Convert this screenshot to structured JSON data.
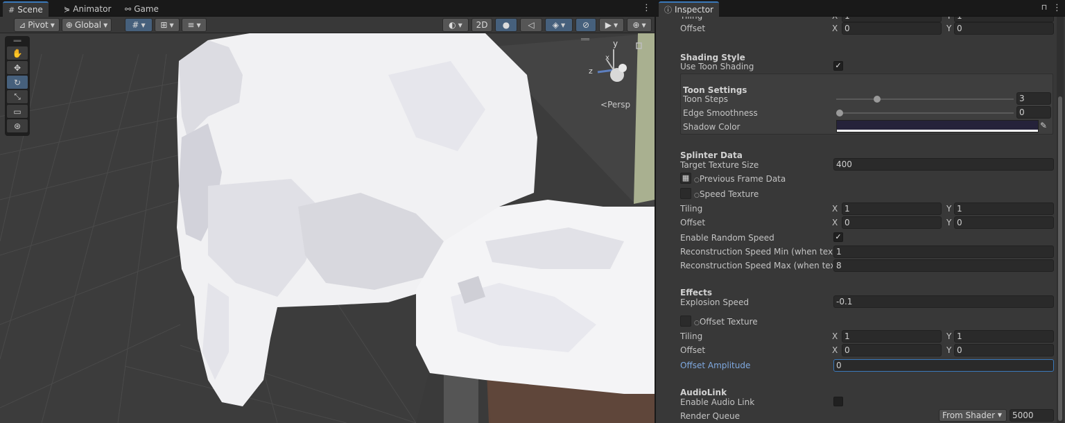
{
  "scene_panel": {
    "tabs": [
      {
        "label": "Scene",
        "icon": "grid-hash-icon"
      },
      {
        "label": "Animator",
        "icon": "animator-icon"
      },
      {
        "label": "Game",
        "icon": "gamepad-icon"
      }
    ],
    "toolbar": {
      "pivot_label": "Pivot",
      "global_label": "Global",
      "mode_2d_label": "2D"
    },
    "tools": [
      "hand-tool",
      "move-tool",
      "rotate-tool",
      "scale-tool",
      "rect-tool",
      "transform-tool"
    ],
    "gizmo": {
      "y_label": "y",
      "z_label": "z",
      "x_label": "x",
      "persp_label": "Persp"
    }
  },
  "inspector": {
    "tab_label": "Inspector",
    "top_partial": {
      "tiling_label": "Tiling",
      "tiling_x": "1",
      "tiling_y": "1"
    },
    "offset_1": {
      "label": "Offset",
      "x": "0",
      "y": "0"
    },
    "shading_style": {
      "header": "Shading Style",
      "use_toon_label": "Use Toon Shading",
      "use_toon_checked": true
    },
    "toon_settings": {
      "header": "Toon Settings",
      "toon_steps_label": "Toon Steps",
      "toon_steps_value": "3",
      "toon_steps_fraction": 0.23,
      "edge_smoothness_label": "Edge Smoothness",
      "edge_smoothness_value": "0",
      "edge_smoothness_fraction": 0.0,
      "shadow_color_label": "Shadow Color",
      "shadow_color": "#25223a"
    },
    "splinter_data": {
      "header": "Splinter Data",
      "target_texture_size_label": "Target Texture Size",
      "target_texture_size_value": "400",
      "previous_frame_label": "Previous Frame Data",
      "speed_texture_label": "Speed Texture",
      "tiling_label": "Tiling",
      "tiling_x": "1",
      "tiling_y": "1",
      "offset_label": "Offset",
      "offset_x": "0",
      "offset_y": "0",
      "enable_random_speed_label": "Enable Random Speed",
      "enable_random_speed_checked": true,
      "recon_min_label": "Reconstruction Speed Min (when textu",
      "recon_min_value": "1",
      "recon_max_label": "Reconstruction Speed Max (when textu",
      "recon_max_value": "8"
    },
    "effects": {
      "header": "Effects",
      "explosion_speed_label": "Explosion Speed",
      "explosion_speed_value": "-0.1",
      "offset_texture_label": "Offset Texture",
      "tiling_label": "Tiling",
      "tiling_x": "1",
      "tiling_y": "1",
      "offset_label": "Offset",
      "offset_x": "0",
      "offset_y": "0",
      "offset_amplitude_label": "Offset Amplitude",
      "offset_amplitude_value": "0"
    },
    "audiolink": {
      "header": "AudioLink",
      "enable_label": "Enable Audio Link",
      "enable_checked": false,
      "render_queue_label": "Render Queue",
      "render_queue_mode": "From Shader",
      "render_queue_value": "5000"
    },
    "axis_x": "X",
    "axis_y": "Y",
    "checkmark": "✓"
  },
  "colors": {
    "accent": "#3a79bb",
    "toggle_on": "#46607c"
  }
}
